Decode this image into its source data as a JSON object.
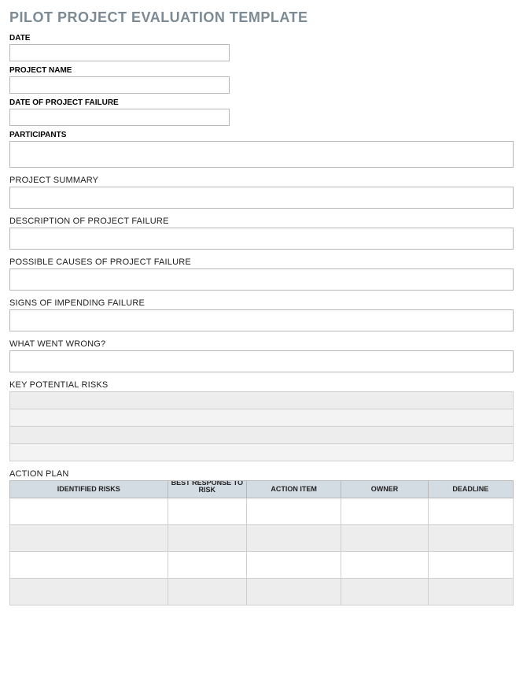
{
  "title": "PILOT PROJECT EVALUATION TEMPLATE",
  "fields": {
    "date_label": "DATE",
    "project_name_label": "PROJECT NAME",
    "date_failure_label": "DATE OF PROJECT FAILURE",
    "participants_label": "PARTICIPANTS",
    "summary_label": "PROJECT SUMMARY",
    "description_label": "DESCRIPTION OF PROJECT FAILURE",
    "causes_label": "POSSIBLE CAUSES OF PROJECT FAILURE",
    "signs_label": "SIGNS OF IMPENDING FAILURE",
    "wrong_label": "WHAT WENT WRONG?",
    "risks_label": "KEY POTENTIAL RISKS",
    "plan_label": "ACTION PLAN"
  },
  "action_plan": {
    "columns": {
      "identified": "IDENTIFIED RISKS",
      "response": "BEST RESPONSE TO RISK",
      "item": "ACTION ITEM",
      "owner": "OWNER",
      "deadline": "DEADLINE"
    }
  },
  "values": {
    "date": "",
    "project_name": "",
    "date_failure": "",
    "participants": "",
    "summary": "",
    "description": "",
    "causes": "",
    "signs": "",
    "wrong": ""
  }
}
